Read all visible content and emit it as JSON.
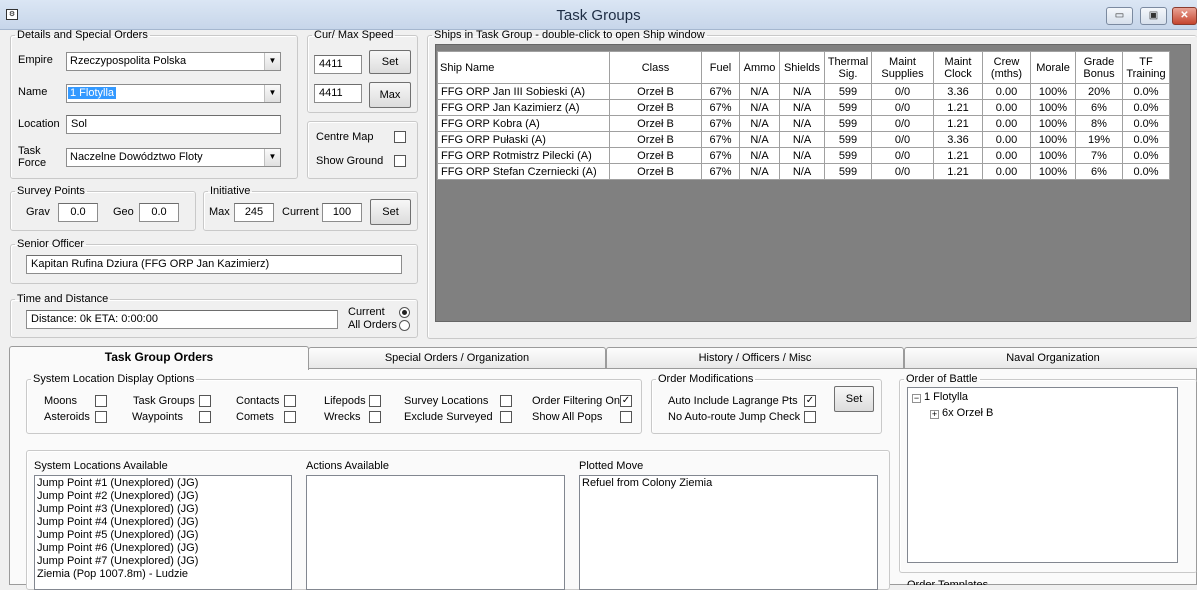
{
  "window": {
    "title": "Task Groups",
    "icon": "app-icon",
    "controls": {
      "minimize": "▭",
      "maximize": "▣",
      "close": "✕"
    }
  },
  "details": {
    "legend": "Details and Special Orders",
    "empire_label": "Empire",
    "empire_value": "Rzeczypospolita Polska",
    "name_label": "Name",
    "name_value": "1 Flotylla",
    "location_label": "Location",
    "location_value": "Sol",
    "task_force_label": "Task Force",
    "task_force_value": "Naczelne Dowództwo Floty",
    "dropdown_glyph": "▼"
  },
  "speed": {
    "legend": "Cur/ Max Speed",
    "current": "4411",
    "max": "4411",
    "set_label": "Set",
    "max_label": "Max"
  },
  "map_options": {
    "centre_map_label": "Centre Map",
    "centre_map_checked": false,
    "show_ground_label": "Show Ground",
    "show_ground_checked": false
  },
  "survey": {
    "legend": "Survey Points",
    "grav_label": "Grav",
    "grav_value": "0.0",
    "geo_label": "Geo",
    "geo_value": "0.0"
  },
  "initiative": {
    "legend": "Initiative",
    "max_label": "Max",
    "max_value": "245",
    "current_label": "Current",
    "current_value": "100",
    "set_label": "Set"
  },
  "senior_officer": {
    "legend": "Senior Officer",
    "value": "Kapitan Rufina Dziura  (FFG ORP Jan Kazimierz)"
  },
  "time_distance": {
    "legend": "Time and Distance",
    "value": "Distance: 0k  ETA: 0:00:00",
    "current_label": "Current",
    "all_orders_label": "All Orders",
    "selected": "current"
  },
  "ships": {
    "legend": "Ships in Task Group - double-click to open Ship window",
    "columns": [
      "Ship Name",
      "Class",
      "Fuel",
      "Ammo",
      "Shields",
      "Thermal Sig.",
      "Maint Supplies",
      "Maint Clock",
      "Crew (mths)",
      "Morale",
      "Grade Bonus",
      "TF Training"
    ],
    "rows": [
      [
        "FFG ORP Jan III Sobieski (A)",
        "Orzeł B",
        "67%",
        "N/A",
        "N/A",
        "599",
        "0/0",
        "3.36",
        "0.00",
        "100%",
        "20%",
        "0.0%"
      ],
      [
        "FFG ORP Jan Kazimierz (A)",
        "Orzeł B",
        "67%",
        "N/A",
        "N/A",
        "599",
        "0/0",
        "1.21",
        "0.00",
        "100%",
        "6%",
        "0.0%"
      ],
      [
        "FFG ORP Kobra (A)",
        "Orzeł B",
        "67%",
        "N/A",
        "N/A",
        "599",
        "0/0",
        "1.21",
        "0.00",
        "100%",
        "8%",
        "0.0%"
      ],
      [
        "FFG ORP Pułaski (A)",
        "Orzeł B",
        "67%",
        "N/A",
        "N/A",
        "599",
        "0/0",
        "3.36",
        "0.00",
        "100%",
        "19%",
        "0.0%"
      ],
      [
        "FFG ORP Rotmistrz Pilecki (A)",
        "Orzeł B",
        "67%",
        "N/A",
        "N/A",
        "599",
        "0/0",
        "1.21",
        "0.00",
        "100%",
        "7%",
        "0.0%"
      ],
      [
        "FFG ORP Stefan Czerniecki (A)",
        "Orzeł B",
        "67%",
        "N/A",
        "N/A",
        "599",
        "0/0",
        "1.21",
        "0.00",
        "100%",
        "6%",
        "0.0%"
      ]
    ]
  },
  "tabs": [
    {
      "label": "Task Group Orders",
      "active": true
    },
    {
      "label": "Special Orders / Organization",
      "active": false
    },
    {
      "label": "History / Officers / Misc",
      "active": false
    },
    {
      "label": "Naval Organization",
      "active": false
    }
  ],
  "display_options": {
    "legend": "System Location Display Options",
    "items": [
      {
        "label": "Moons",
        "checked": false
      },
      {
        "label": "Asteroids",
        "checked": false
      },
      {
        "label": "Task Groups",
        "checked": false
      },
      {
        "label": "Waypoints",
        "checked": false
      },
      {
        "label": "Contacts",
        "checked": false
      },
      {
        "label": "Comets",
        "checked": false
      },
      {
        "label": "Lifepods",
        "checked": false
      },
      {
        "label": "Wrecks",
        "checked": false
      },
      {
        "label": "Survey Locations",
        "checked": false
      },
      {
        "label": "Exclude Surveyed",
        "checked": false
      },
      {
        "label": "Order Filtering On",
        "checked": true
      },
      {
        "label": "Show All Pops",
        "checked": false
      }
    ]
  },
  "order_mods": {
    "legend": "Order Modifications",
    "lagrange_label": "Auto Include Lagrange Pts",
    "lagrange_checked": true,
    "no_jump_label": "No Auto-route Jump Check",
    "no_jump_checked": false,
    "set_label": "Set"
  },
  "system_locations": {
    "label": "System Locations Available",
    "items": [
      "Jump Point #1  (Unexplored) (JG)",
      "Jump Point #2  (Unexplored) (JG)",
      "Jump Point #3  (Unexplored) (JG)",
      "Jump Point #4  (Unexplored) (JG)",
      "Jump Point #5  (Unexplored) (JG)",
      "Jump Point #6  (Unexplored) (JG)",
      "Jump Point #7  (Unexplored) (JG)",
      "Ziemia  (Pop 1007.8m) - Ludzie"
    ]
  },
  "actions": {
    "label": "Actions Available",
    "items": []
  },
  "plotted_move": {
    "label": "Plotted Move",
    "items": [
      "Refuel from Colony Ziemia"
    ]
  },
  "order_of_battle": {
    "legend": "Order of Battle",
    "root": "1 Flotylla",
    "root_toggle": "−",
    "child": "6x Orzeł B",
    "child_toggle": "+",
    "templates_label": "Order Templates"
  }
}
